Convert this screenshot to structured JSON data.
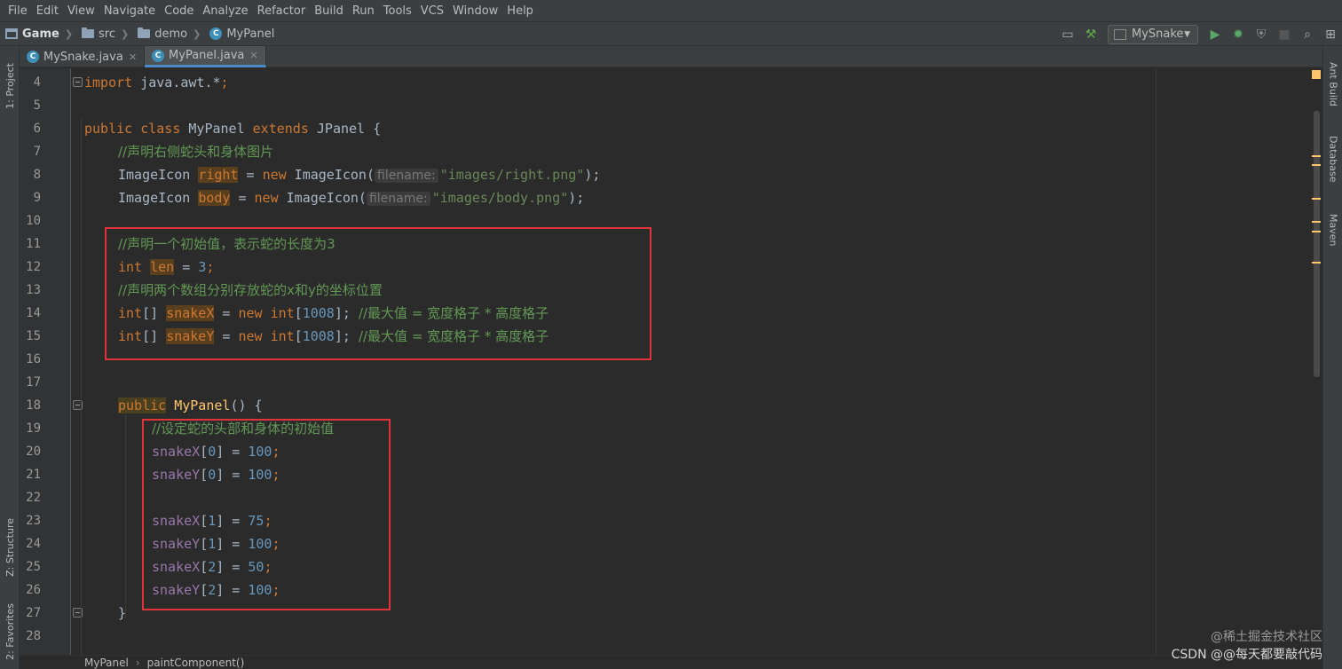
{
  "menu": [
    "File",
    "Edit",
    "View",
    "Navigate",
    "Code",
    "Analyze",
    "Refactor",
    "Build",
    "Run",
    "Tools",
    "VCS",
    "Window",
    "Help"
  ],
  "breadcrumbs": {
    "project": "Game",
    "src": "src",
    "package": "demo",
    "class": "MyPanel"
  },
  "run_config": "MySnake",
  "tabs": [
    {
      "label": "MySnake.java",
      "active": false
    },
    {
      "label": "MyPanel.java",
      "active": true
    }
  ],
  "left_tools": {
    "project": "1: Project",
    "structure": "Z: Structure",
    "favorites": "2: Favorites"
  },
  "right_tools": {
    "ant": "Ant Build",
    "database": "Database",
    "maven": "Maven"
  },
  "gutter_lines": [
    "4",
    "5",
    "6",
    "7",
    "8",
    "9",
    "10",
    "11",
    "12",
    "13",
    "14",
    "15",
    "16",
    "17",
    "18",
    "19",
    "20",
    "21",
    "22",
    "23",
    "24",
    "25",
    "26",
    "27",
    "28"
  ],
  "code": {
    "l4": {
      "kw": "import",
      "rest": " java.awt.*",
      "semi": ";"
    },
    "l6": {
      "kw1": "public class",
      "name": " MyPanel ",
      "kw2": "extends",
      "rest": " JPanel {"
    },
    "l7": "//声明右侧蛇头和身体图片",
    "l8": {
      "type": "ImageIcon ",
      "field": "right",
      "mid": " = ",
      "kw": "new",
      "ctor": " ImageIcon(",
      "hint": "filename:",
      "str": "\"images/right.png\"",
      "end": ");"
    },
    "l9": {
      "type": "ImageIcon ",
      "field": "body",
      "mid": " = ",
      "kw": "new",
      "ctor": " ImageIcon(",
      "hint": "filename:",
      "str": "\"images/body.png\"",
      "end": ");"
    },
    "l11": "//声明一个初始值，表示蛇的长度为3",
    "l12": {
      "kw": "int ",
      "field": "len",
      "mid": " = ",
      "num": "3",
      "end": ";"
    },
    "l13": "//声明两个数组分别存放蛇的x和y的坐标位置",
    "l14": {
      "kw": "int",
      "br": "[] ",
      "field": "snakeX",
      "mid": " = ",
      "kw2": "new ",
      "kw3": "int",
      "open": "[",
      "num": "1008",
      "close": "]; ",
      "cmt": "//最大值 = 宽度格子 * 高度格子"
    },
    "l15": {
      "kw": "int",
      "br": "[] ",
      "field": "snakeY",
      "mid": " = ",
      "kw2": "new ",
      "kw3": "int",
      "open": "[",
      "num": "1008",
      "close": "]; ",
      "cmt": "//最大值 = 宽度格子 * 高度格子"
    },
    "l18": {
      "kw": "public",
      "name": " MyPanel",
      "rest": "() {"
    },
    "l19": "//设定蛇的头部和身体的初始值",
    "assign": [
      {
        "line": 20,
        "f": "snakeX",
        "i": "0",
        "v": "100"
      },
      {
        "line": 21,
        "f": "snakeY",
        "i": "0",
        "v": "100"
      },
      {
        "line": 23,
        "f": "snakeX",
        "i": "1",
        "v": "75"
      },
      {
        "line": 24,
        "f": "snakeY",
        "i": "1",
        "v": "100"
      },
      {
        "line": 25,
        "f": "snakeX",
        "i": "2",
        "v": "50"
      },
      {
        "line": 26,
        "f": "snakeY",
        "i": "2",
        "v": "100"
      }
    ],
    "l27": "}"
  },
  "footer": {
    "class": "MyPanel",
    "method": "paintComponent()"
  },
  "watermark": {
    "line1": "@稀土掘金技术社区",
    "line2": "CSDN @@每天都要敲代码"
  }
}
